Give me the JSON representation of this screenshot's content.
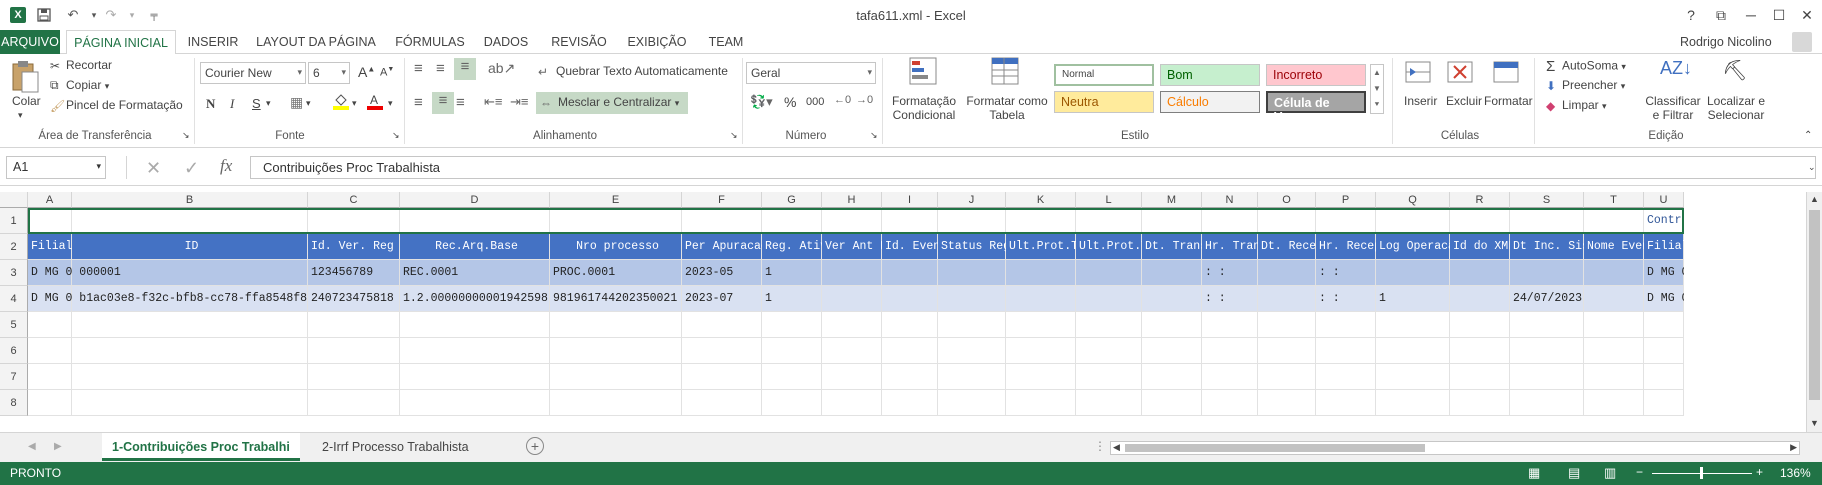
{
  "window": {
    "title": "tafa611.xml - Excel",
    "help": "?",
    "min": "─",
    "max": "☐",
    "close": "✕",
    "restore": "⧉"
  },
  "qat": {
    "save": "save-icon",
    "undo": "↶",
    "redo": "↷"
  },
  "tabs": [
    "ARQUIVO",
    "PÁGINA INICIAL",
    "INSERIR",
    "LAYOUT DA PÁGINA",
    "FÓRMULAS",
    "DADOS",
    "REVISÃO",
    "EXIBIÇÃO",
    "TEAM"
  ],
  "user": "Rodrigo Nicolino",
  "ribbon": {
    "clipboard": {
      "paste": "Colar",
      "cut": "Recortar",
      "copy": "Copiar",
      "painter": "Pincel de Formatação",
      "label": "Área de Transferência"
    },
    "font": {
      "name": "Courier New",
      "size": "6",
      "bold": "N",
      "italic": "I",
      "underline": "S",
      "grow": "A",
      "shrink": "A",
      "label": "Fonte"
    },
    "alignment": {
      "wrap": "Quebrar Texto Automaticamente",
      "merge": "Mesclar e Centralizar",
      "label": "Alinhamento"
    },
    "number": {
      "format": "Geral",
      "percent": "%",
      "thousands": "000",
      "label": "Número"
    },
    "styles": {
      "cond": "Formatação\nCondicional",
      "table": "Formatar como\nTabela",
      "normal": "Normal",
      "bom": "Bom",
      "incorreto": "Incorreto",
      "neutra": "Neutra",
      "calculo": "Cálculo",
      "celula": "Célula de Ve...",
      "label": "Estilo"
    },
    "cells": {
      "insert": "Inserir",
      "delete": "Excluir",
      "format": "Formatar",
      "label": "Células"
    },
    "editing": {
      "autosum": "AutoSoma",
      "fill": "Preencher",
      "clear": "Limpar",
      "sort": "Classificar\ne Filtrar",
      "find": "Localizar e\nSelecionar",
      "label": "Edição"
    }
  },
  "formula": {
    "namebox": "A1",
    "fx": "fx",
    "content": "Contribuições Proc Trabalhista"
  },
  "columns": [
    "A",
    "B",
    "C",
    "D",
    "E",
    "F",
    "G",
    "H",
    "I",
    "J",
    "K",
    "L",
    "M",
    "N",
    "O",
    "P",
    "Q",
    "R",
    "S",
    "T",
    "U"
  ],
  "rows": [
    "1",
    "2",
    "3",
    "4",
    "5",
    "6",
    "7",
    "8"
  ],
  "sheet": {
    "r1_title": "Contribu",
    "headers": [
      "Filial",
      "ID",
      "Id. Ver. Reg",
      "Rec.Arq.Base",
      "Nro processo",
      "Per Apuracao",
      "Reg. Ativo",
      "Ver Ant Reg",
      "Id. Evento",
      "Status Reg.",
      "Ult.Prot.Tr",
      "Ult.Prot.Tr",
      "Dt. Transm",
      "Hr. Transm",
      "Dt. Recept",
      "Hr. Recept",
      "Log Operacao",
      "Id do XML",
      "Dt Inc. Sist",
      "Nome Evento",
      "Filial"
    ],
    "row3": [
      "D MG 0 000001",
      "",
      "123456789",
      "REC.0001",
      "PROC.0001",
      "2023-05",
      "1",
      "",
      "",
      "",
      "",
      "",
      "",
      " :  :",
      "",
      " :  :",
      "",
      "",
      "",
      "",
      "D MG 0 0"
    ],
    "row4": [
      "D MG 0 b1ac03e8-f32c-bfb8-cc78-ffa8548f8",
      "",
      "240723475818",
      "1.2.00000000001942598",
      "981961744202350021",
      "2023-07",
      "1",
      "",
      "",
      "",
      "",
      "",
      "",
      " :  :",
      "",
      " :  :",
      "1",
      "",
      "24/07/2023",
      "",
      "D MG 0 b"
    ]
  },
  "sheets": [
    "1-Contribuições Proc Trabalhi",
    "2-Irrf Processo Trabalhista"
  ],
  "status": {
    "ready": "PRONTO",
    "zoom": "136%"
  }
}
